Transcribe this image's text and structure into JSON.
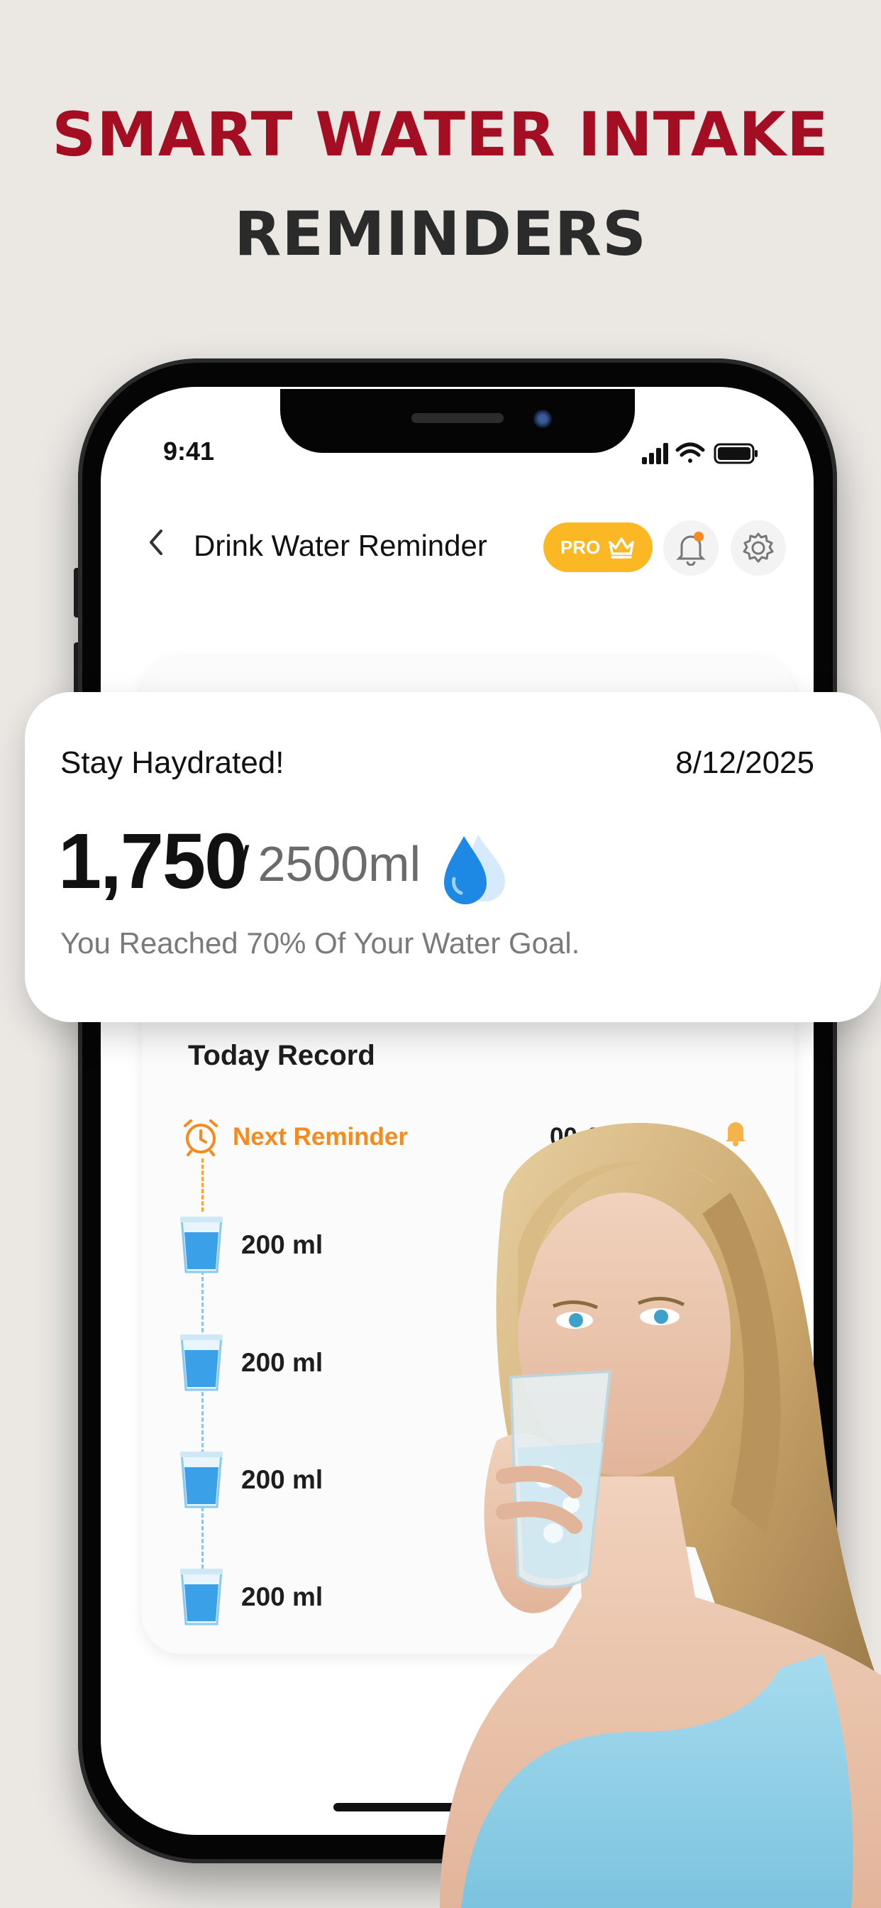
{
  "headline": {
    "line1": "SMART WATER INTAKE",
    "line2": "REMINDERS"
  },
  "status_bar": {
    "time": "9:41"
  },
  "nav": {
    "back_icon": "chevron-left-icon",
    "title": "Drink Water Reminder",
    "pro_label": "PRO",
    "pro_icon": "crown-icon",
    "bell_icon": "bell-icon",
    "settings_icon": "gear-icon"
  },
  "summary": {
    "greeting": "Stay Haydrated!",
    "date": "8/12/2025",
    "current": "1,750",
    "goal": "2500ml",
    "message": "You Reached 70% Of Your Water Goal.",
    "progress_percent": 70
  },
  "today_record": {
    "title": "Today Record",
    "next_reminder_label": "Next Reminder",
    "next_reminder_time": "00:15:0",
    "entries": [
      {
        "amount": "200 ml"
      },
      {
        "amount": "200 ml"
      },
      {
        "amount": "200 ml"
      },
      {
        "amount": "200 ml"
      }
    ]
  },
  "colors": {
    "headline_red": "#a40e23",
    "headline_dark": "#2b2b2b",
    "pro_yellow": "#fbb824",
    "reminder_orange": "#f58a1f",
    "water_blue": "#3aa0e8",
    "background": "#ebe8e4"
  }
}
